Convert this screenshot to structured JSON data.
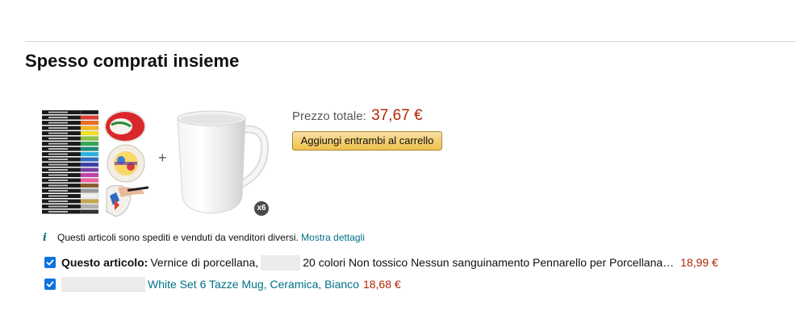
{
  "section": {
    "title": "Spesso comprati insieme"
  },
  "bundle": {
    "plus": "+",
    "quantity_badge": "x6",
    "total_label": "Prezzo totale:",
    "total_value": "37,67 €",
    "add_both_label": "Aggiungi entrambi al carrello"
  },
  "info": {
    "icon": "i",
    "text": "Questi articoli sono spediti e venduti da venditori diversi.",
    "link": "Mostra dettagli"
  },
  "items": [
    {
      "checked": true,
      "prefix": "Questo articolo:",
      "title_start": "Vernice di porcellana,",
      "title_end": "20 colori Non tossico Nessun sanguinamento Pennarello per Porcellana…",
      "price": "18,99 €"
    },
    {
      "checked": true,
      "title": "White Set 6 Tazze Mug, Ceramica, Bianco",
      "price": "18,68 €"
    }
  ],
  "colors": {
    "price": "#b12704",
    "link": "#007185",
    "checkbox": "#0b74de",
    "button": "#f0c14b"
  },
  "icons": {
    "info": "info-icon",
    "check": "check-icon"
  }
}
